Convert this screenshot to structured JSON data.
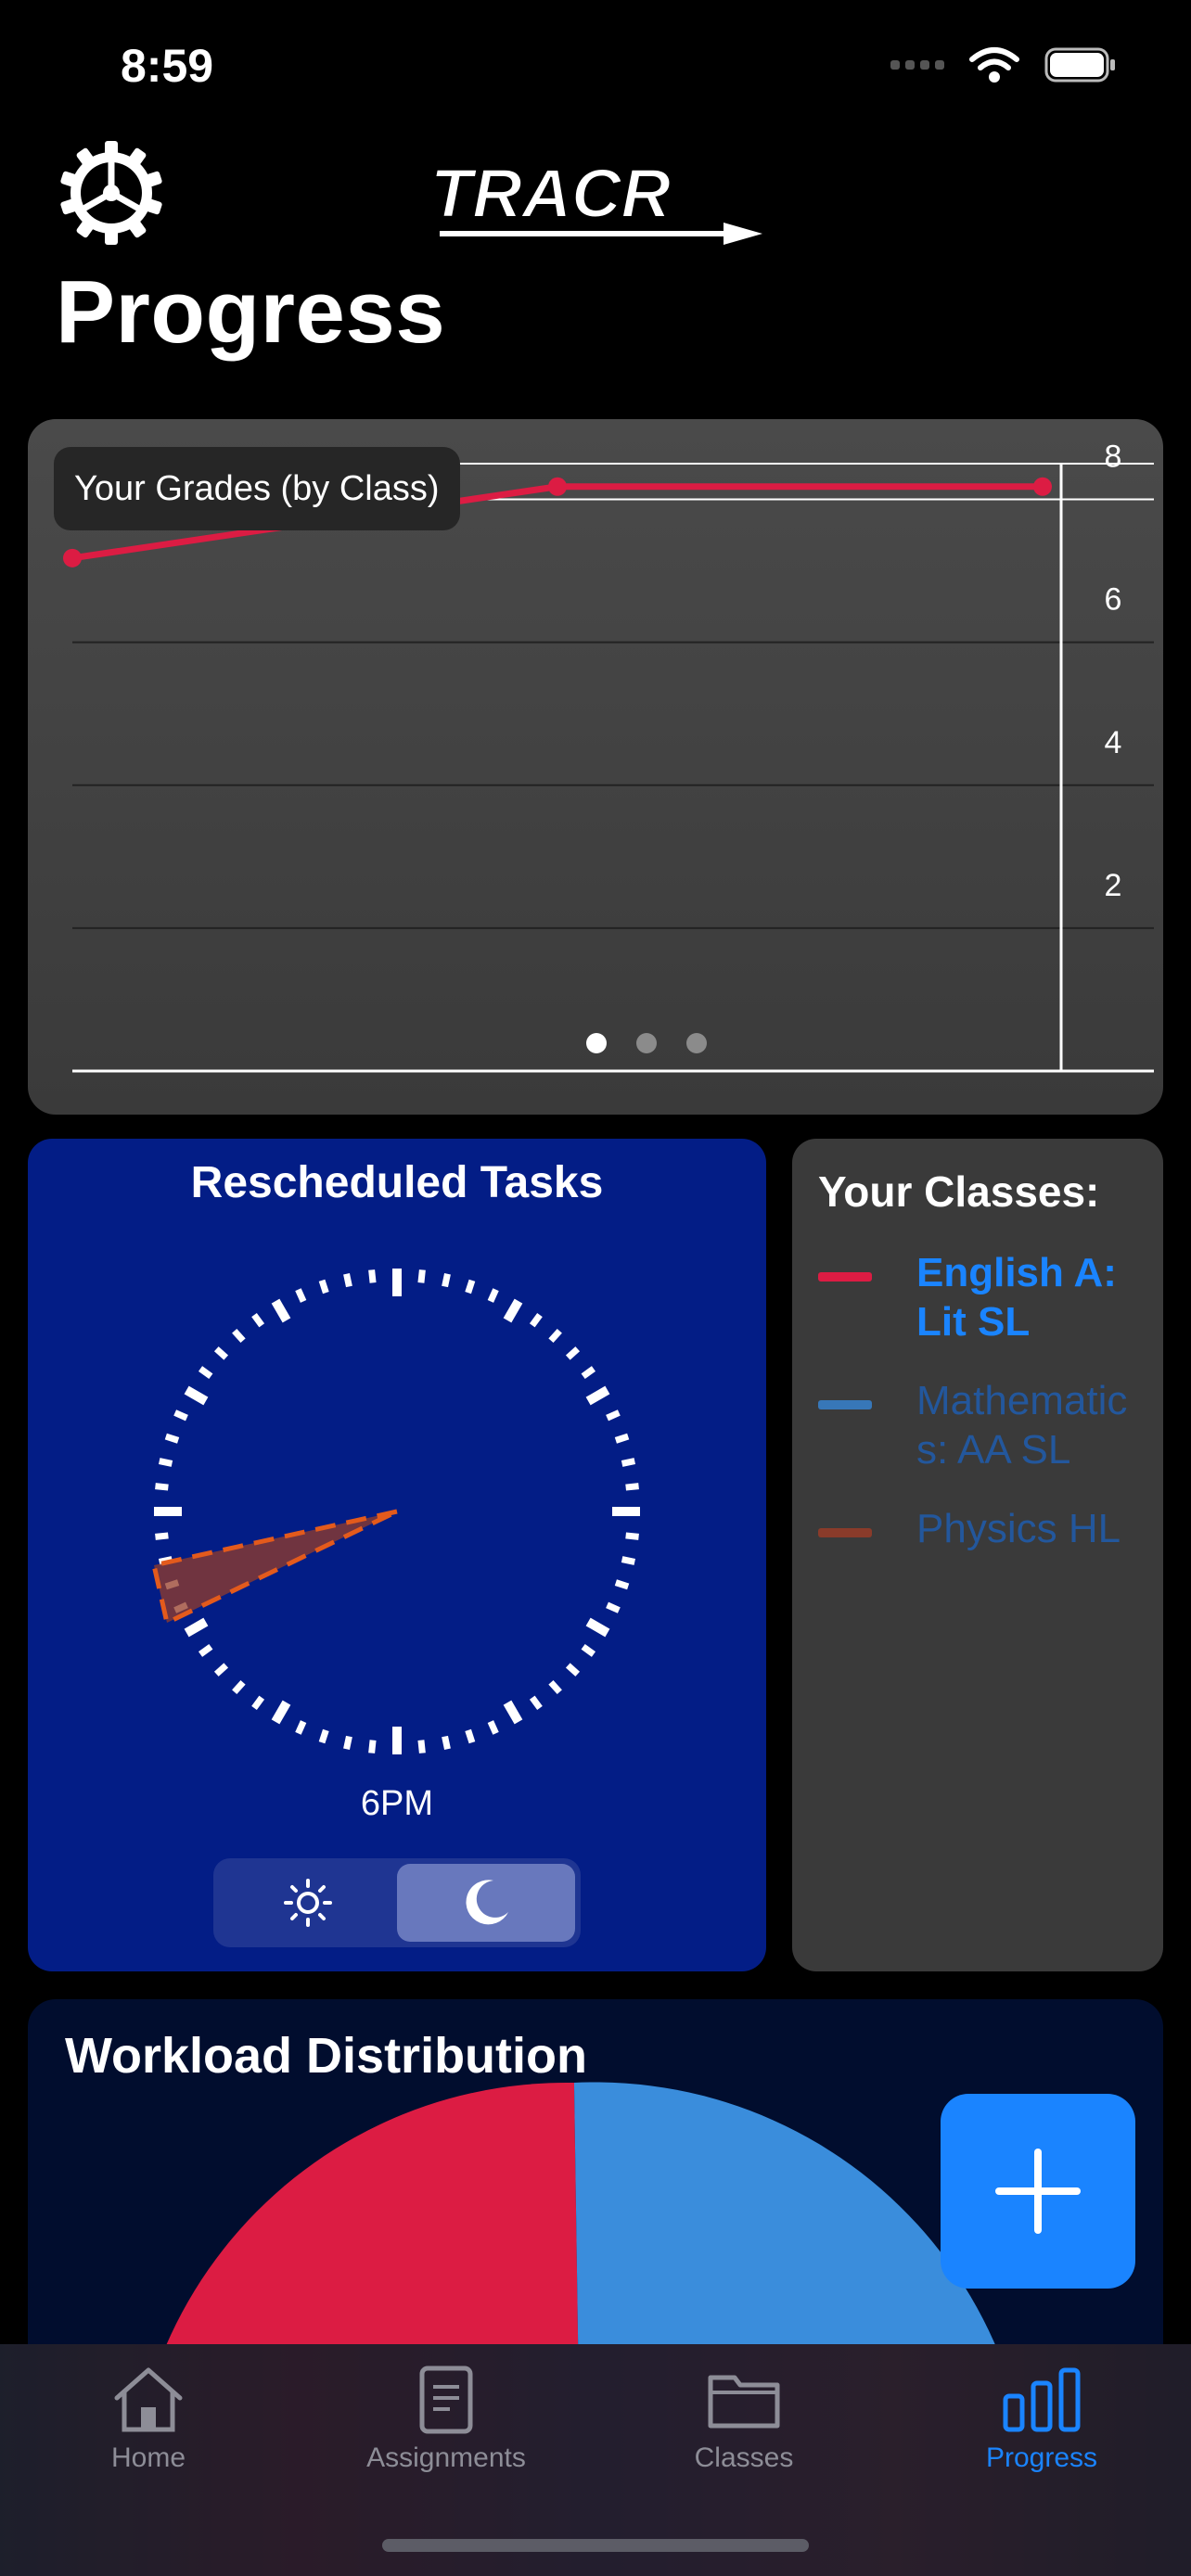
{
  "status_bar": {
    "time": "8:59"
  },
  "header": {
    "logo_text": "TRACR",
    "title": "Progress"
  },
  "grades_chart": {
    "title": "Your Grades (by Class)",
    "y_ticks": [
      "8",
      "6",
      "4",
      "2"
    ],
    "pages_total": 3,
    "page_active": 1
  },
  "rescheduled": {
    "title": "Rescheduled Tasks",
    "time_caption": "6PM",
    "mode_day_icon": "sun-icon",
    "mode_night_icon": "moon-icon",
    "mode_selected": "night"
  },
  "classes": {
    "title": "Your Classes:",
    "items": [
      {
        "label": "English A: Lit SL",
        "color": "#dc1c43",
        "text_color": "#1a84ff",
        "selected": true
      },
      {
        "label": "Mathematics: AA SL",
        "color": "#3777b8",
        "text_color": "#23579c",
        "selected": false
      },
      {
        "label": "Physics HL",
        "color": "#8a3b2a",
        "text_color": "#23579c",
        "selected": false
      }
    ]
  },
  "workload": {
    "title": "Workload Distribution"
  },
  "fab": {
    "icon": "plus-icon"
  },
  "tabs": [
    {
      "label": "Home",
      "icon": "house-icon",
      "active": false
    },
    {
      "label": "Assignments",
      "icon": "document-icon",
      "active": false
    },
    {
      "label": "Classes",
      "icon": "folder-icon",
      "active": false
    },
    {
      "label": "Progress",
      "icon": "bar-chart-icon",
      "active": true
    }
  ],
  "colors": {
    "accent": "#1a84ff",
    "english": "#dc1c43",
    "math": "#3a8ddc",
    "physics": "#b0501e",
    "resched_bg": "#031d86"
  },
  "chart_data": [
    {
      "type": "line",
      "title": "Your Grades (by Class)",
      "x": [
        1,
        2,
        3
      ],
      "series": [
        {
          "name": "English A: Lit SL",
          "values": [
            6.4,
            7.4,
            7.4
          ]
        }
      ],
      "y_ticks": [
        2,
        4,
        6,
        8
      ],
      "ylim": [
        0,
        8.5
      ],
      "grid": true
    },
    {
      "type": "pie",
      "title": "Workload Distribution",
      "categories": [
        "English A: Lit SL",
        "Mathematics: AA SL"
      ],
      "values": [
        50,
        50
      ]
    }
  ]
}
